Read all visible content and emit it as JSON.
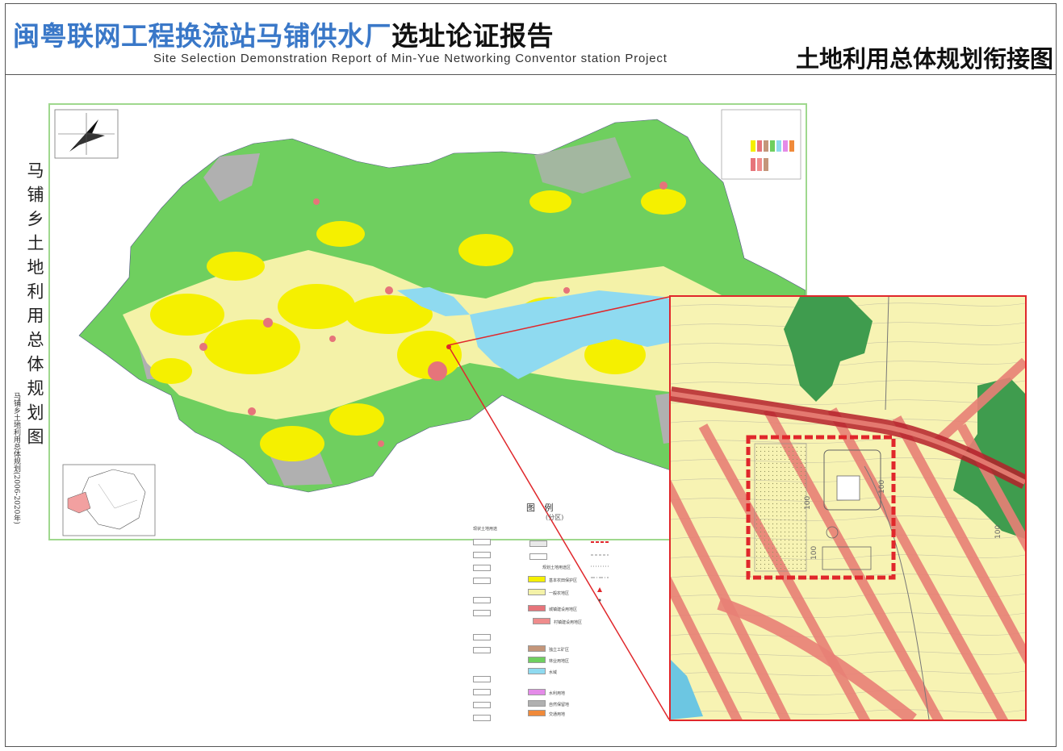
{
  "header": {
    "title_blue": "闽粤联网工程换流站马铺供水厂",
    "title_black": "选址论证报告",
    "subtitle_en": "Site Selection Demonstration Report of Min-Yue Networking Conventor station Project",
    "drawing_name": "土地利用总体规划衔接图"
  },
  "map": {
    "vertical_title": "马铺乡土地利用总体规划图",
    "vertical_subtitle": "马铺乡土地利用总体规划(2006-2020年)",
    "legend_title": "图 例",
    "legend_subtitle": "(分区)",
    "legend_sections": {
      "current_land": "现状土地用途",
      "planned_zone": "规划土地用途区"
    },
    "legend_items": [
      {
        "label": "基本农田保护区",
        "color": "#f5f000"
      },
      {
        "label": "一般农地区",
        "color": "#f4f2a8"
      },
      {
        "label": "城镇建设用地区",
        "color": "#e6747a"
      },
      {
        "label": "村镇建设用地区",
        "color": "#ef8c8c"
      },
      {
        "label": "独立工矿区",
        "color": "#c4967a"
      },
      {
        "label": "林业用地区",
        "color": "#6fcf5f"
      },
      {
        "label": "水域",
        "color": "#8fdaf0"
      },
      {
        "label": "自然保留地",
        "color": "#b0b0b0"
      },
      {
        "label": "交通用地",
        "color": "#f08a3a"
      },
      {
        "label": "水利用地",
        "color": "#e48be8"
      }
    ],
    "inset": {
      "contour_labels": [
        "100",
        "100",
        "100",
        "100"
      ]
    }
  },
  "colors": {
    "title_blue": "#3a78c8",
    "inset_border": "#e0272b",
    "forest": "#6fcf5f",
    "basic_farmland": "#f5f000",
    "general_farm": "#f4f2a8",
    "water": "#8fdaf0",
    "reserve": "#b0b0b0",
    "construction": "#e6747a"
  }
}
